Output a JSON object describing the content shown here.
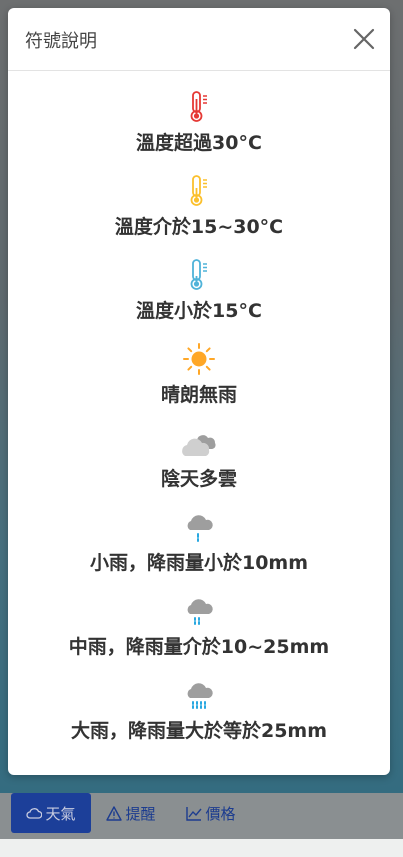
{
  "modal": {
    "title": "符號說明",
    "items": [
      {
        "icon": "thermometer-hot-icon",
        "color": "#e53935",
        "label": "溫度超過30°C"
      },
      {
        "icon": "thermometer-warm-icon",
        "color": "#fbc02d",
        "label": "溫度介於15~30°C"
      },
      {
        "icon": "thermometer-cold-icon",
        "color": "#4fb3d9",
        "label": "溫度小於15°C"
      },
      {
        "icon": "sunny-icon",
        "color": "#ff9800",
        "label": "晴朗無雨"
      },
      {
        "icon": "cloudy-icon",
        "color": "#b0b0b0",
        "label": "陰天多雲"
      },
      {
        "icon": "light-rain-icon",
        "color": "#29a8e0",
        "label": "小雨，降雨量小於10mm"
      },
      {
        "icon": "moderate-rain-icon",
        "color": "#29a8e0",
        "label": "中雨，降雨量介於10~25mm"
      },
      {
        "icon": "heavy-rain-icon",
        "color": "#29a8e0",
        "label": "大雨，降雨量大於等於25mm"
      }
    ]
  },
  "nav": {
    "weather": "天氣",
    "reminder": "提醒",
    "price": "價格"
  }
}
